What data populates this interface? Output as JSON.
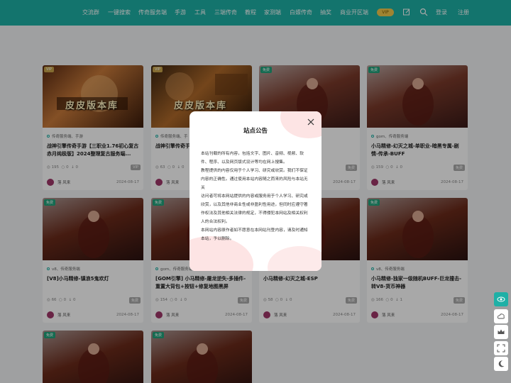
{
  "nav": {
    "items": [
      "交流群",
      "一键搜索",
      "传奇服务端",
      "手游",
      "工具",
      "三端传奇",
      "教程",
      "家测端",
      "白嫖传奇",
      "抽奖",
      "商业开区端"
    ],
    "vip": "VIP",
    "login": "登录",
    "register": "注册"
  },
  "cards": [
    {
      "tag": "VIP",
      "cats": "传奇服务端、手游",
      "title": "战神引擎传奇手游【三职业1.76初心复古赤月纯极版】2024整理复古服务端...",
      "views": "195",
      "comments": "0",
      "downloads": "0",
      "badge": "VIP",
      "author": "落 风来",
      "date": "2024-08-17"
    },
    {
      "tag": "VIP",
      "cats": "传奇服务端、手",
      "title": "战神引擎传奇手大陆二开版】2...",
      "views": "63",
      "comments": "0",
      "downloads": "0",
      "badge": "",
      "author": "落 风来",
      "date": ""
    },
    {
      "tag": "免费",
      "cats": "",
      "title": "...默-V8新增大星UI",
      "views": "",
      "comments": "",
      "downloads": "",
      "badge": "免费",
      "author": "",
      "date": "2024-08-17"
    },
    {
      "tag": "免费",
      "cats": "gom、传奇服务端",
      "title": "小马精修-幻灭之城-单职业-暗黑专属-剧情-传承-BUFF",
      "views": "159",
      "comments": "0",
      "downloads": "0",
      "badge": "免费",
      "author": "落 风来",
      "date": "2024-08-17"
    },
    {
      "tag": "免费",
      "cats": "v8、传奇服务端",
      "title": "[V8]小马精修-镇浪5鬼欢灯",
      "views": "66",
      "comments": "0",
      "downloads": "0",
      "badge": "免费",
      "author": "落 风来",
      "date": "2024-08-17"
    },
    {
      "tag": "免费",
      "cats": "gom、传奇服务端",
      "title": "[GOM引擎] 小马精修-屠龙逆失-多插件-重置大背包+按钮+修复地图黑屏",
      "views": "154",
      "comments": "0",
      "downloads": "0",
      "badge": "免费",
      "author": "落 风来",
      "date": "2024-08-17"
    },
    {
      "tag": "免费",
      "cats": "",
      "title": "小马精修-幻灭之城-ESP",
      "views": "58",
      "comments": "0",
      "downloads": "0",
      "badge": "免费",
      "author": "落 风来",
      "date": "2024-08-17"
    },
    {
      "tag": "免费",
      "cats": "v8、传奇服务端",
      "title": "小马精修-独家一级随机BUFF-巨龙撞击-转V8-货币神器",
      "views": "166",
      "comments": "0",
      "downloads": "1",
      "badge": "免费",
      "author": "落 风来",
      "date": "2024-08-17"
    },
    {
      "tag": "免费"
    },
    {
      "tag": "免费"
    }
  ],
  "thumb_text": "皮皮版本库",
  "modal": {
    "title": "站点公告",
    "lines": [
      "本站刊载的所有内容，包括文字、图片、音频、视频、软件、程序、以及网页版式设计等均在网上搜集。",
      "教程提供的内容仅用于个人学习、研究或欣赏。我们不保证内容的正确性。通过使用本站内容随之而来的风险与本站无关",
      "访问者可将本网站提供的内容或服务用于个人学习、研究或欣赏，以及其他非商业性或非盈利性用途，但同时应遵守著作权法及其他相关法律的规定，不得侵犯本网站及相关权利人的合法权利。",
      "本网站内容原作者如不愿意在本网站刊登内容，请及时通知本站，予以删除。"
    ]
  },
  "colors": {
    "brand": "#1eb0a6",
    "free_tag": "#21a37c",
    "vip_tag": "#c8a44b"
  }
}
